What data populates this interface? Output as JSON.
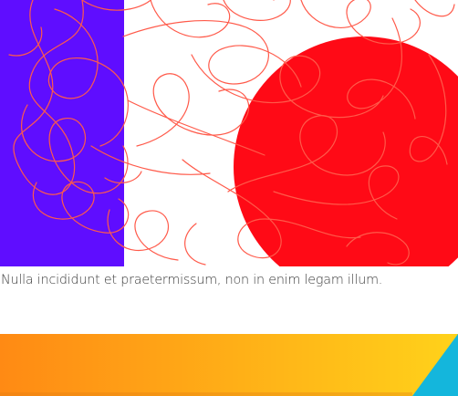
{
  "caption": {
    "text": "Nulla incididunt et praetermissum, non in enim legam illum."
  },
  "artwork": {
    "colors": {
      "panel": "#5f0dff",
      "circle": "#ff0a16",
      "scribble": "#ff5a4a",
      "background": "#ffffff"
    }
  },
  "banner": {
    "colors": {
      "gradient_start": "#ff8a14",
      "gradient_end": "#ffd21a",
      "accent": "#14b6dc"
    }
  }
}
